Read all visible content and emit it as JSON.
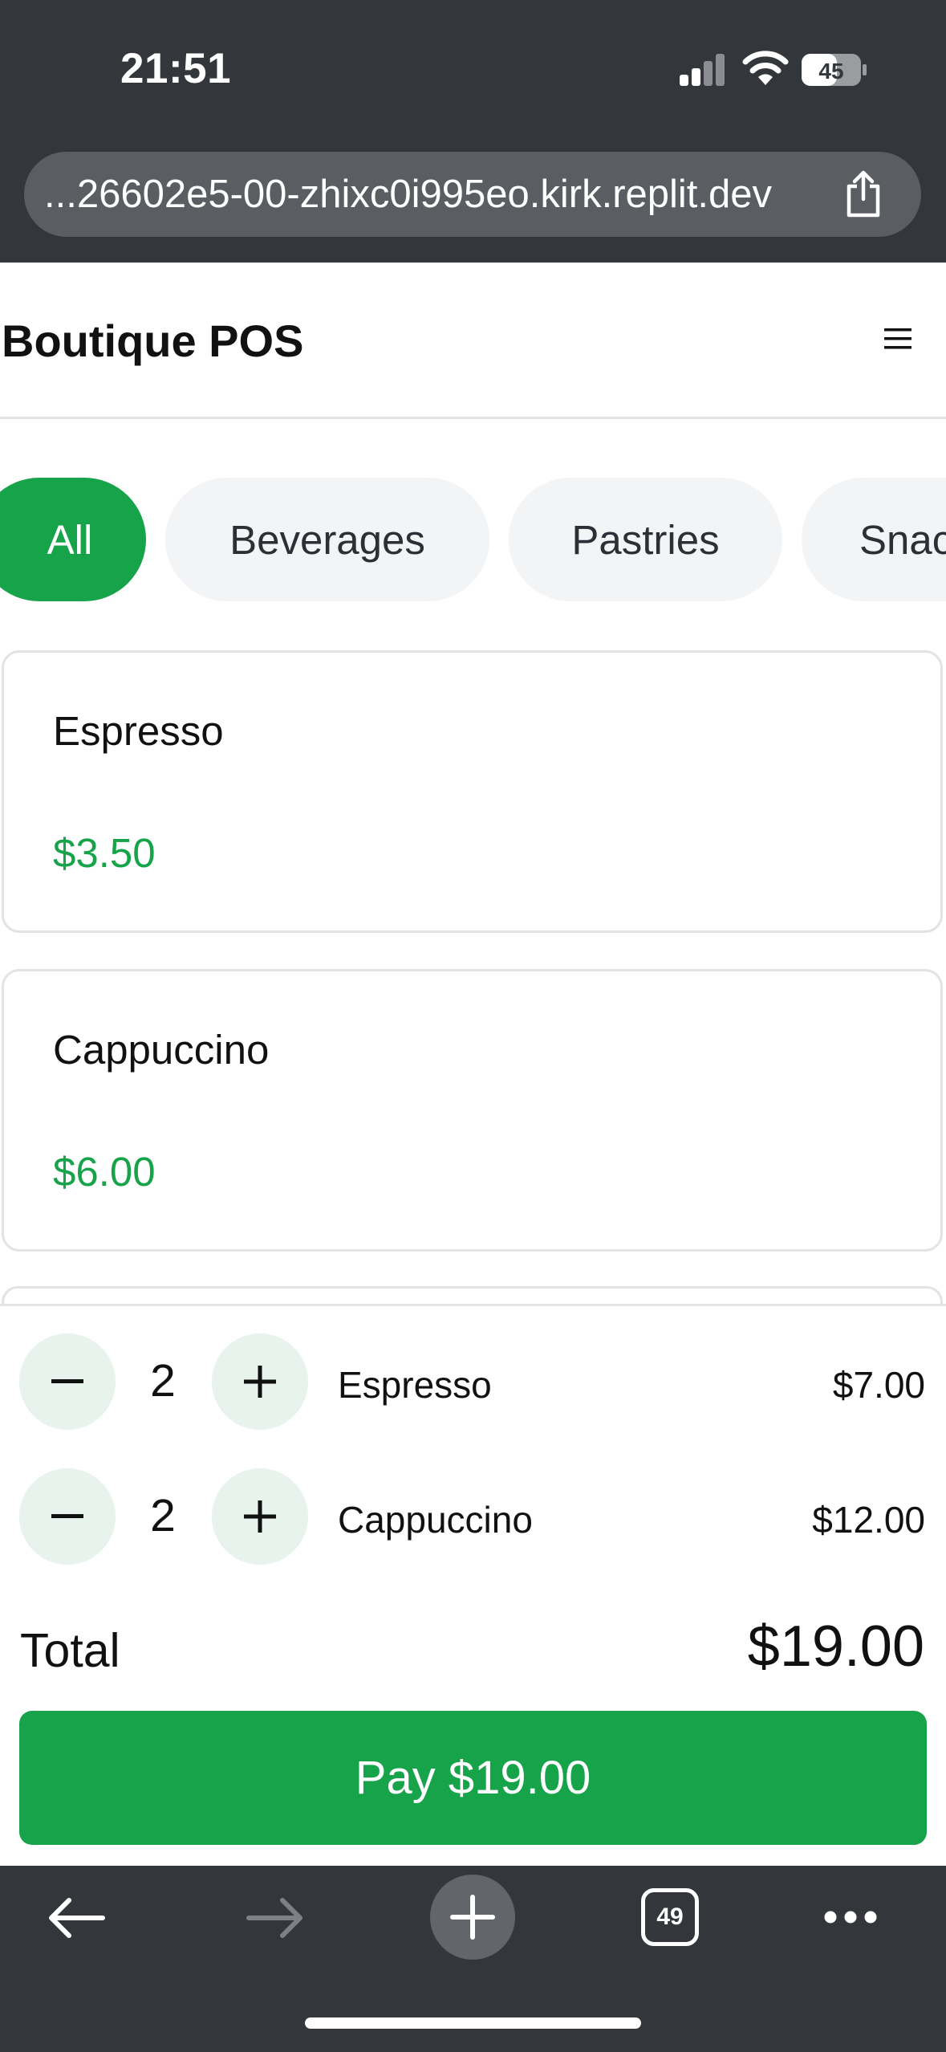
{
  "status_bar": {
    "time": "21:51",
    "battery": "45"
  },
  "browser": {
    "url": "...26602e5-00-zhixc0i995eo.kirk.replit.dev",
    "tab_count": "49"
  },
  "app": {
    "title": "Boutique POS"
  },
  "categories": [
    {
      "label": "All",
      "active": true
    },
    {
      "label": "Beverages",
      "active": false
    },
    {
      "label": "Pastries",
      "active": false
    },
    {
      "label": "Snacks",
      "active": false
    }
  ],
  "products": [
    {
      "name": "Espresso",
      "price": "$3.50"
    },
    {
      "name": "Cappuccino",
      "price": "$6.00"
    }
  ],
  "cart": {
    "items": [
      {
        "qty": "2",
        "name": "Espresso",
        "amount": "$7.00"
      },
      {
        "qty": "2",
        "name": "Cappuccino",
        "amount": "$12.00"
      }
    ],
    "total_label": "Total",
    "total_value": "$19.00",
    "pay_label": "Pay $19.00"
  },
  "colors": {
    "accent": "#16a34a",
    "chrome": "#33363a",
    "chip_bg": "#f3f4f6",
    "qty_bg": "#e7f3ec"
  }
}
